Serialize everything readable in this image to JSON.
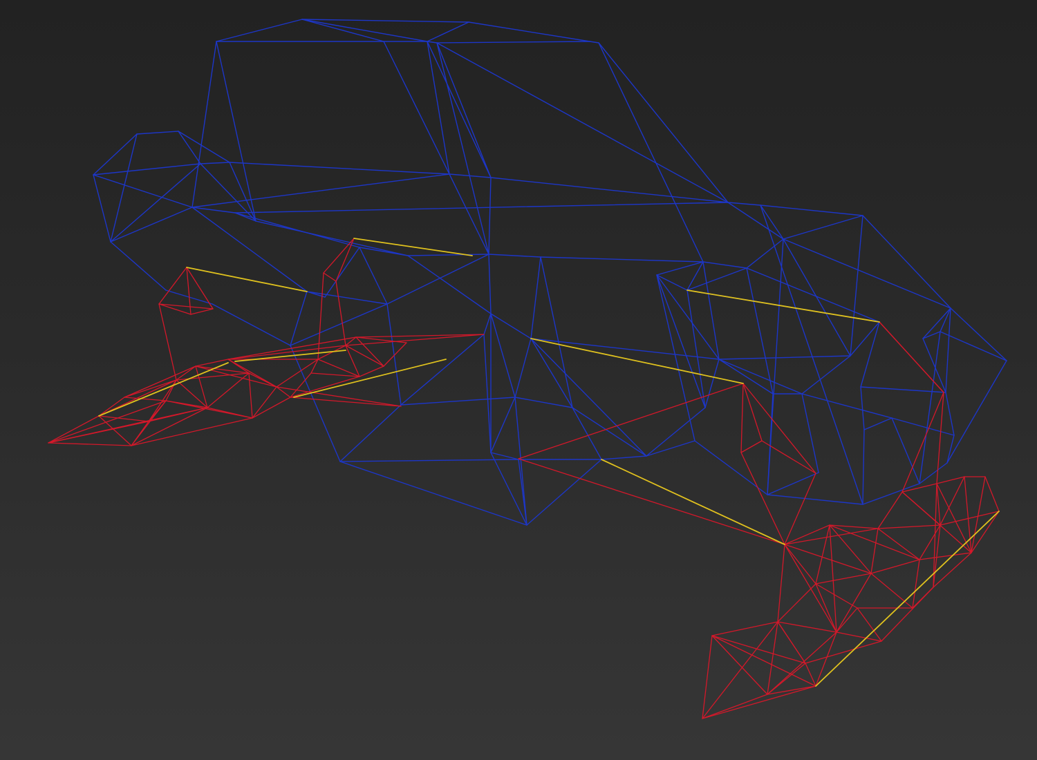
{
  "viewport": {
    "colors": {
      "frame": "#1d36c8",
      "pods": "#d4182a",
      "links": "#e0c21e",
      "background_top": "#222222",
      "background_bottom": "#363636"
    }
  }
}
